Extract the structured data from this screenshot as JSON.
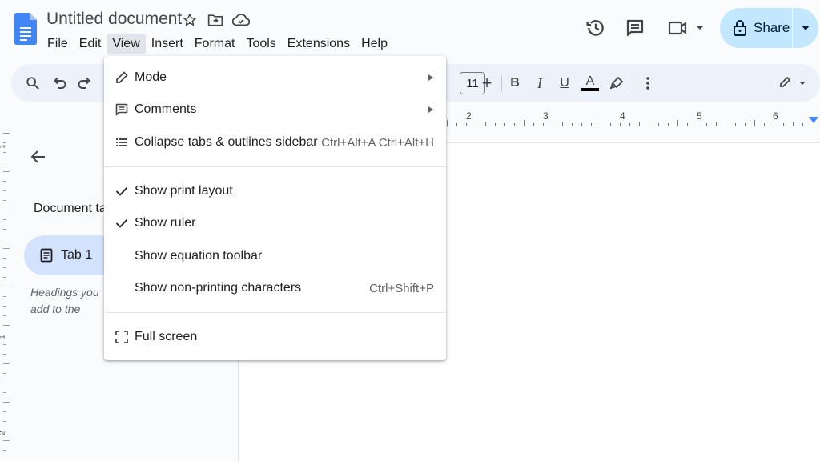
{
  "header": {
    "doc_title": "Untitled document",
    "menu": [
      "File",
      "Edit",
      "View",
      "Insert",
      "Format",
      "Tools",
      "Extensions",
      "Help"
    ],
    "active_menu": "View",
    "share_label": "Share"
  },
  "toolbar": {
    "font_size": "11",
    "bold": "B",
    "italic": "I",
    "underline": "U",
    "text_color_letter": "A"
  },
  "ruler": {
    "numbers": [
      "2",
      "3",
      "4",
      "5",
      "6"
    ]
  },
  "left_ruler": {
    "numbers": [
      "1",
      "1",
      "2"
    ]
  },
  "sidebar": {
    "title": "Document tabs",
    "tab_label": "Tab 1",
    "hint": "Headings you add to the document will appear here."
  },
  "view_menu": {
    "items": [
      {
        "label": "Mode",
        "shortcut": "",
        "submenu": true
      },
      {
        "label": "Comments",
        "shortcut": "",
        "submenu": true
      },
      {
        "label": "Collapse tabs & outlines sidebar",
        "shortcut": "Ctrl+Alt+A Ctrl+Alt+H",
        "submenu": false
      },
      {
        "label": "Show print layout",
        "shortcut": "",
        "checked": true
      },
      {
        "label": "Show ruler",
        "shortcut": "",
        "checked": true
      },
      {
        "label": "Show equation toolbar",
        "shortcut": "",
        "checked": false
      },
      {
        "label": "Show non-printing characters",
        "shortcut": "Ctrl+Shift+P",
        "checked": false
      },
      {
        "label": "Full screen",
        "shortcut": ""
      }
    ]
  },
  "colors": {
    "accent": "#0b57d0",
    "share_bg": "#c2e7ff",
    "toolbar_bg": "#edf2fa",
    "active_tab_bg": "#d3e3fd"
  }
}
